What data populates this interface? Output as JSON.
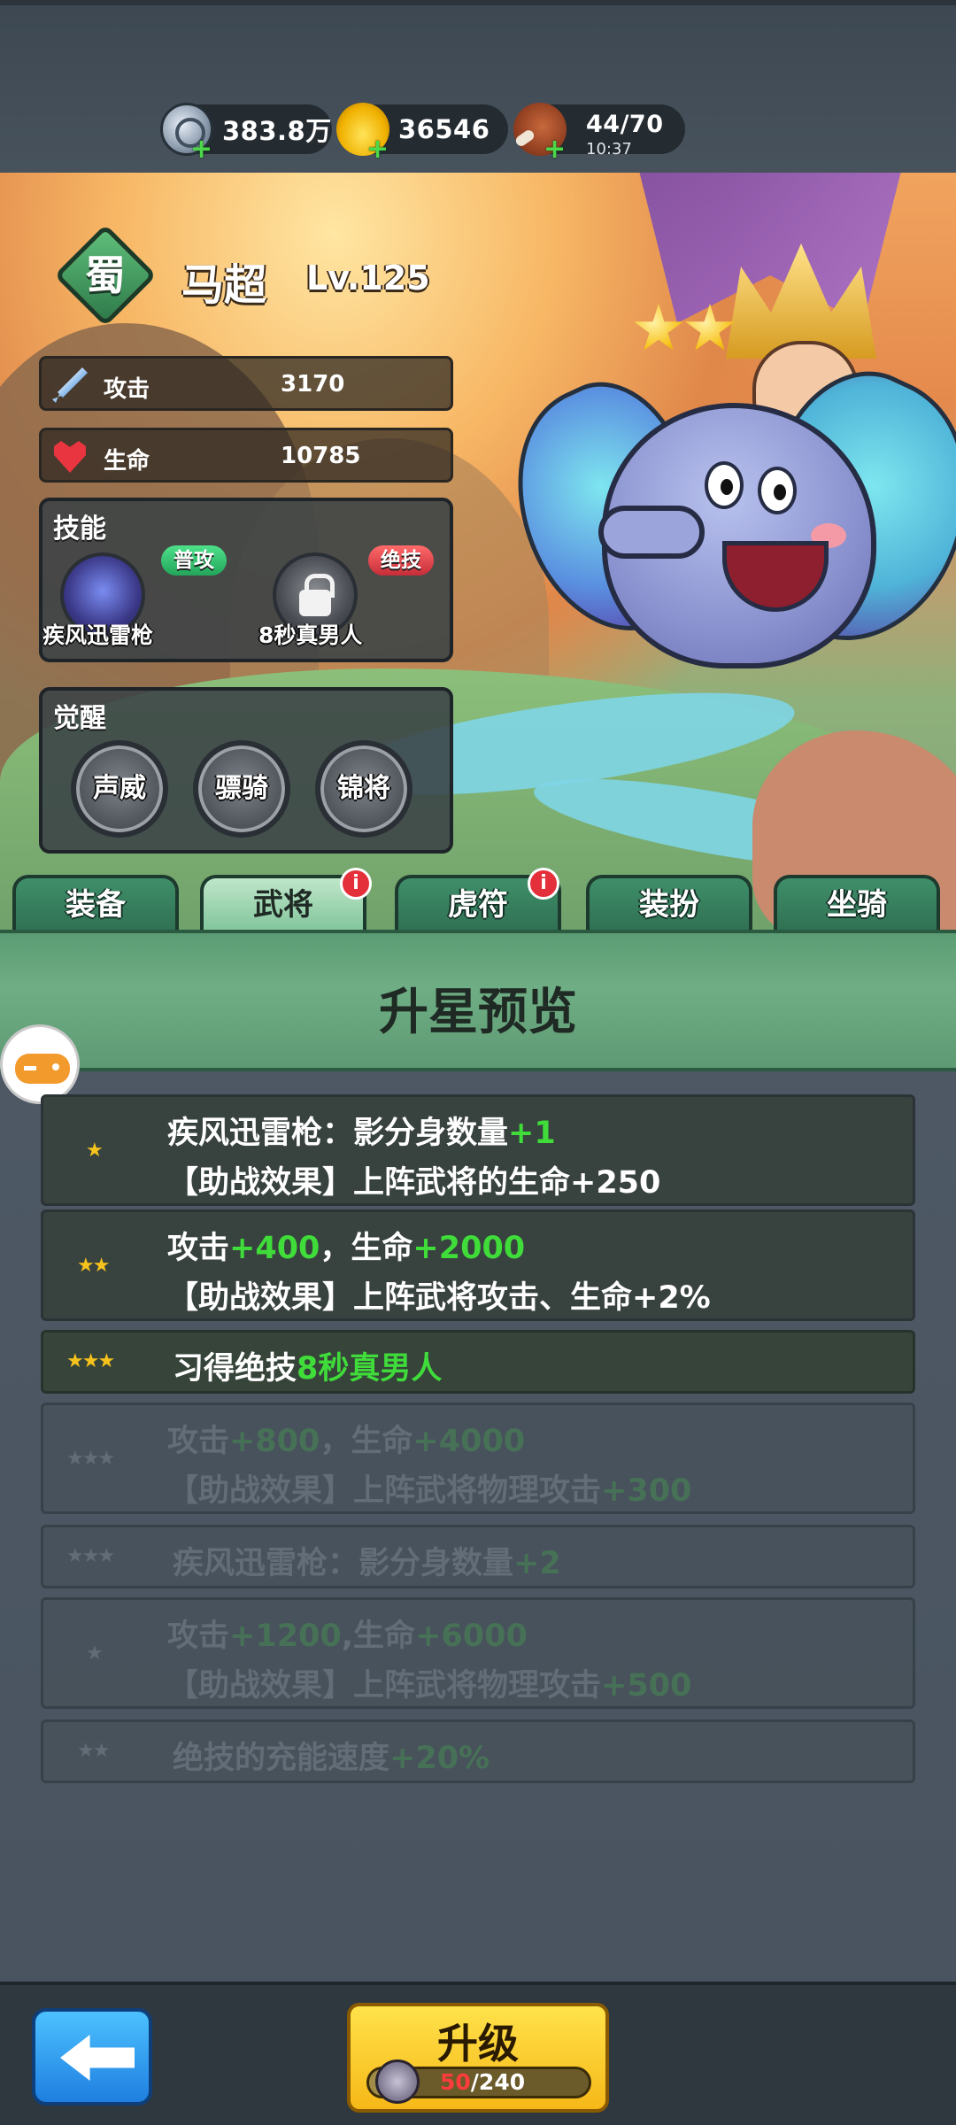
{
  "resources": {
    "silver": {
      "value": "383.8万",
      "icon": "silver-coin-icon"
    },
    "gold": {
      "value": "36546",
      "icon": "gold-ingot-icon"
    },
    "stamina": {
      "value": "44/70",
      "timer": "10:37",
      "icon": "meat-icon"
    }
  },
  "hero": {
    "faction": "蜀",
    "name": "马超",
    "level": "Lv.125",
    "star_count": 2,
    "stats": [
      {
        "label": "攻击",
        "value": "3170",
        "icon": "sword-icon"
      },
      {
        "label": "生命",
        "value": "10785",
        "icon": "heart-icon"
      }
    ]
  },
  "skills": {
    "title": "技能",
    "items": [
      {
        "tag": "普攻",
        "name": "疾风迅雷枪",
        "locked": false
      },
      {
        "tag": "绝技",
        "name": "8秒真男人",
        "locked": true
      }
    ]
  },
  "awaken": {
    "title": "觉醒",
    "items": [
      "声威",
      "骠骑",
      "锦将"
    ]
  },
  "tabs": [
    {
      "label": "装备",
      "badge": false
    },
    {
      "label": "武将",
      "badge": true,
      "active": true
    },
    {
      "label": "虎符",
      "badge": true
    },
    {
      "label": "装扮",
      "badge": false
    },
    {
      "label": "坐骑",
      "badge": false
    }
  ],
  "badge_text": "i",
  "section_title": "升星预览",
  "star_rows": [
    {
      "stars": "★",
      "lines": [
        [
          "疾风迅雷枪：影分身数量",
          "+1",
          ""
        ],
        [
          "【助战效果】上阵武将的生命+250",
          "",
          ""
        ]
      ],
      "state": "done"
    },
    {
      "stars": "★★",
      "lines": [
        [
          "攻击",
          "+400",
          "，生命",
          "+2000"
        ],
        [
          "【助战效果】上阵武将攻击、生命+2%",
          "",
          ""
        ]
      ],
      "state": "done"
    },
    {
      "stars": "★★★",
      "lines": [
        [
          "习得绝技",
          "8秒真男人",
          ""
        ]
      ],
      "state": "highlight"
    },
    {
      "stars": "★★★",
      "lines": [
        [
          "攻击",
          "+800",
          "，生命",
          "+4000"
        ],
        [
          "【助战效果】上阵武将物理攻击",
          "+300",
          ""
        ]
      ],
      "state": "dim"
    },
    {
      "stars": "★★★",
      "lines": [
        [
          "疾风迅雷枪：影分身数量",
          "+2",
          ""
        ]
      ],
      "state": "dim"
    },
    {
      "stars": "★",
      "lines": [
        [
          "攻击",
          "+1200",
          ",生命",
          "+6000"
        ],
        [
          "【助战效果】上阵武将物理攻击",
          "+500",
          ""
        ]
      ],
      "state": "dim"
    },
    {
      "stars": "★★",
      "lines": [
        [
          "绝技的充能速度",
          "+20%",
          ""
        ]
      ],
      "state": "dim"
    }
  ],
  "bottom": {
    "back_icon": "back-arrow-icon",
    "upgrade_label": "升级",
    "progress_current": "50",
    "progress_total": "/240",
    "progress_fraction": 0.208
  },
  "colors": {
    "accent_green": "#3fdc3a",
    "tab_green": "#3f8f6a",
    "upgrade_yellow": "#f6b818",
    "back_blue": "#1f7fe0"
  }
}
